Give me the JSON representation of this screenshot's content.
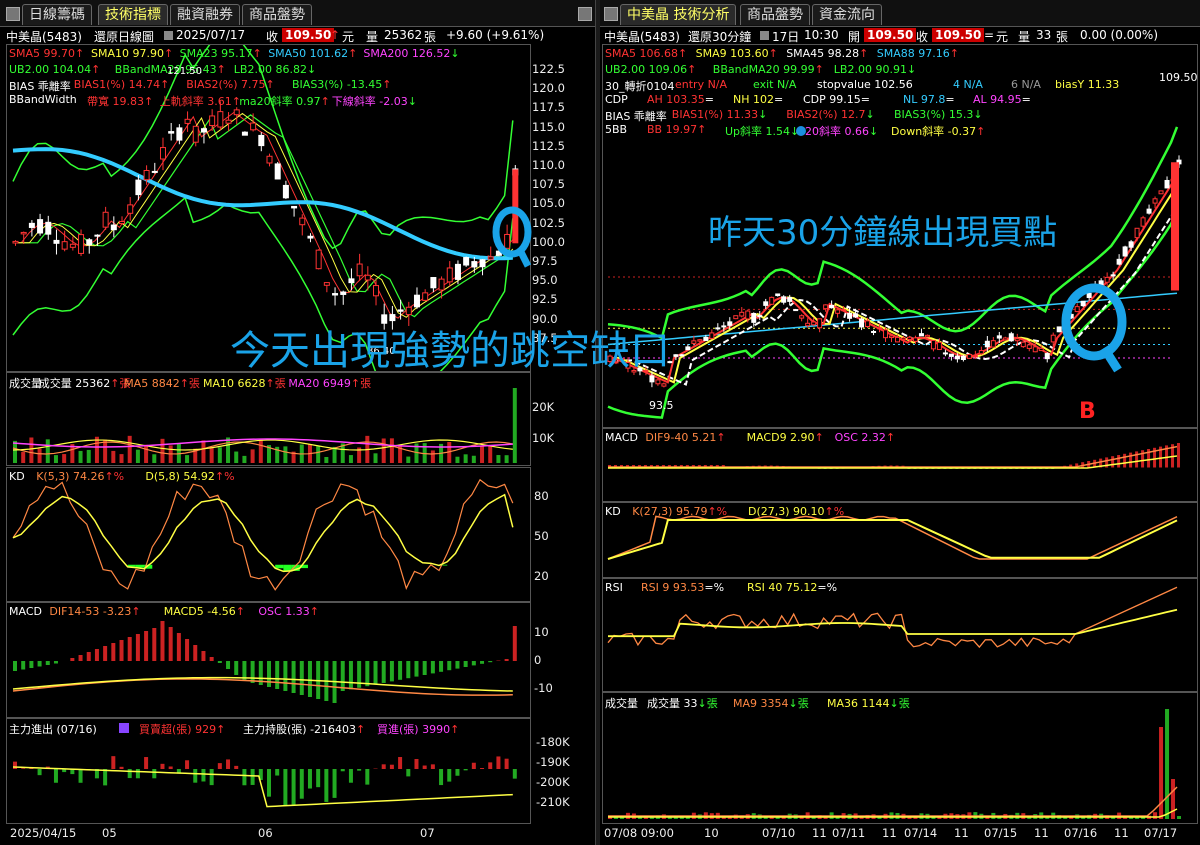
{
  "left": {
    "tabs": [
      "日線籌碼",
      "技術指標",
      "融資融券",
      "商品盤勢"
    ],
    "header": {
      "stock": "中美晶(5483)",
      "chart_mode": "還原日線圖",
      "date": "2025/07/17",
      "close_label": "收",
      "close": "109.50",
      "unit": "元",
      "vol_label": "量",
      "volume": "25362",
      "vol_unit": "張",
      "change": "+9.60 (+9.61%)"
    },
    "price_legend": {
      "row1": [
        {
          "text": "SMA5 99.70",
          "arrow": "↑",
          "color": "#ff3333"
        },
        {
          "text": "SMA10 97.90",
          "arrow": "↑",
          "color": "#ffff44"
        },
        {
          "text": "SMA23 95.17",
          "arrow": "↑",
          "color": "#33ff33"
        },
        {
          "text": "SMA50 101.62",
          "arrow": "↑",
          "color": "#33ccff"
        },
        {
          "text": "SMA200 126.52",
          "arrow": "↓",
          "color": "#ff44ff"
        }
      ],
      "row2": [
        {
          "text": "UB2.00 104.04",
          "arrow": "↑",
          "color": "#33ff33"
        },
        {
          "text": "BBandMA20 95.43",
          "arrow": "↑",
          "color": "#33ff33"
        },
        {
          "text": "LB2.00 86.82",
          "arrow": "↓",
          "color": "#33ff33"
        }
      ],
      "row3": [
        {
          "text": "BIAS 乖離率",
          "arrow": "",
          "color": "#ffffff"
        },
        {
          "text": "BIAS1(%) 14.74",
          "arrow": "↑",
          "color": "#ff3333"
        },
        {
          "text": "BIAS2(%) 7.75",
          "arrow": "↑",
          "color": "#ff3333"
        },
        {
          "text": "BIAS3(%) -13.45",
          "arrow": "↑",
          "color": "#33ff33"
        }
      ],
      "row4": [
        {
          "text": "BBandWidth",
          "arrow": "",
          "color": "#ffffff"
        },
        {
          "text": "帶寬 19.83",
          "arrow": "↑",
          "color": "#ff3333"
        },
        {
          "text": "上軌斜率 3.61",
          "arrow": "↑",
          "color": "#ff3333"
        },
        {
          "text": "ma20斜率 0.97",
          "arrow": "↑",
          "color": "#33ff33"
        },
        {
          "text": "下線斜率 -2.03",
          "arrow": "↓",
          "color": "#ff44ff"
        }
      ]
    },
    "price_axis": [
      "122.5",
      "120.0",
      "117.5",
      "115.0",
      "112.5",
      "110.0",
      "107.5",
      "105.0",
      "102.5",
      "100.0",
      "97.5",
      "95.0",
      "92.5",
      "90.0",
      "87.5"
    ],
    "price_notes": {
      "high": "121.50",
      "low": "86.40"
    },
    "volume_legend": [
      {
        "text": "成交量",
        "arrow": "",
        "color": "#ffffff"
      },
      {
        "text": "成交量 25362",
        "arrow": "↑張",
        "color": "#ffffff"
      },
      {
        "text": "MA5 8842",
        "arrow": "↑張",
        "color": "#ff8844"
      },
      {
        "text": "MA10 6628",
        "arrow": "↑張",
        "color": "#ffff44"
      },
      {
        "text": "MA20 6949",
        "arrow": "↑張",
        "color": "#ff44ff"
      }
    ],
    "volume_axis": [
      "20K",
      "10K"
    ],
    "kd_legend": [
      {
        "text": "KD",
        "arrow": "",
        "color": "#ffffff"
      },
      {
        "text": "K(5,3) 74.26",
        "arrow": "↑%",
        "color": "#ff8844"
      },
      {
        "text": "D(5,8) 54.92",
        "arrow": "↑%",
        "color": "#ffff44"
      }
    ],
    "kd_axis": [
      "80",
      "50",
      "20"
    ],
    "macd_legend": [
      {
        "text": "MACD",
        "arrow": "",
        "color": "#ffffff"
      },
      {
        "text": "DIF14-53 -3.23",
        "arrow": "↑",
        "color": "#ff8844"
      },
      {
        "text": "MACD5 -4.56",
        "arrow": "↑",
        "color": "#ffff44"
      },
      {
        "text": "OSC 1.33",
        "arrow": "↑",
        "color": "#ff44ff"
      }
    ],
    "macd_axis": [
      "10",
      "0",
      "-10"
    ],
    "main_legend": [
      {
        "text": "主力進出 (07/16)",
        "arrow": "",
        "color": "#ffffff"
      },
      {
        "text": "買賣超(張) 929",
        "arrow": "↑",
        "color": "#ff3333"
      },
      {
        "text": "主力持股(張) -216403",
        "arrow": "↑",
        "color": "#ffffff"
      },
      {
        "text": "買進(張) 3990",
        "arrow": "↑",
        "color": "#ff44ff"
      }
    ],
    "main_axis": [
      "-180K",
      "-190K",
      "-200K",
      "-210K"
    ],
    "x_axis": [
      "2025/04/15",
      "05",
      "06",
      "07"
    ],
    "annotation": "今天出現強勢的跳空缺口"
  },
  "right": {
    "tabs": [
      "中美晶 技術分析",
      "商品盤勢",
      "資金流向"
    ],
    "header": {
      "stock": "中美晶(5483)",
      "chart_mode": "還原30分鐘",
      "day": "17日",
      "time": "10:30",
      "open_label": "開",
      "open": "109.50",
      "close_label": "收",
      "close": "109.50",
      "unit": "元",
      "vol_label": "量",
      "volume": "33",
      "vol_unit": "張",
      "change": "0.00 (0.00%)"
    },
    "price_legend": {
      "row1": [
        {
          "text": "SMA5 106.68",
          "arrow": "↑",
          "color": "#ff3333"
        },
        {
          "text": "SMA9 103.60",
          "arrow": "↑",
          "color": "#ffff44"
        },
        {
          "text": "SMA45 98.28",
          "arrow": "↑",
          "color": "#ffffff"
        },
        {
          "text": "SMA88 97.16",
          "arrow": "↑",
          "color": "#33ccff"
        }
      ],
      "row2": [
        {
          "text": "UB2.00 109.06",
          "arrow": "↑",
          "color": "#33ff33"
        },
        {
          "text": "BBandMA20 99.99",
          "arrow": "↑",
          "color": "#33ff33"
        },
        {
          "text": "LB2.00 90.91",
          "arrow": "↓",
          "color": "#33ff33"
        }
      ],
      "row3": [
        {
          "text": "30_轉折0104",
          "arrow": "",
          "color": "#ffffff"
        },
        {
          "text": "entry N/A",
          "arrow": "",
          "color": "#ff3333"
        },
        {
          "text": "exit N/A",
          "arrow": "",
          "color": "#33ff33"
        },
        {
          "text": "stopvalue 102.56",
          "arrow": "",
          "color": "#ffffff"
        },
        {
          "text": "4 N/A",
          "arrow": "",
          "color": "#33ccff"
        },
        {
          "text": "6 N/A",
          "arrow": "",
          "color": "#999999"
        },
        {
          "text": "biasY 11.33",
          "arrow": "",
          "color": "#ffff44"
        }
      ],
      "row4": [
        {
          "text": "CDP",
          "arrow": "",
          "color": "#ffffff"
        },
        {
          "text": "AH 103.35",
          "arrow": "=",
          "color": "#ff3333"
        },
        {
          "text": "NH 102",
          "arrow": "=",
          "color": "#ffff44"
        },
        {
          "text": "CDP 99.15",
          "arrow": "=",
          "color": "#ffffff"
        },
        {
          "text": "NL 97.8",
          "arrow": "=",
          "color": "#33ccff"
        },
        {
          "text": "AL 94.95",
          "arrow": "=",
          "color": "#ff44ff"
        }
      ],
      "row5": [
        {
          "text": "BIAS 乖離率",
          "arrow": "",
          "color": "#ffffff"
        },
        {
          "text": "BIAS1(%) 11.33",
          "arrow": "↓",
          "color": "#ff3333"
        },
        {
          "text": "BIAS2(%) 12.7",
          "arrow": "↓",
          "color": "#ff3333"
        },
        {
          "text": "BIAS3(%) 15.3",
          "arrow": "↓",
          "color": "#33ff33"
        }
      ],
      "row6": [
        {
          "text": "5BB",
          "arrow": "",
          "color": "#ffffff"
        },
        {
          "text": "BB 19.97",
          "arrow": "↑",
          "color": "#ff3333"
        },
        {
          "text": "Up斜率 1.54",
          "arrow": "↓",
          "color": "#33ff33"
        },
        {
          "text": "20斜率 0.66",
          "arrow": "↓",
          "color": "#ff44ff"
        },
        {
          "text": "Down斜率 -0.37",
          "arrow": "↑",
          "color": "#ffff44"
        }
      ]
    },
    "price_notes": {
      "high": "109.50",
      "low": "93.5",
      "signal": "B"
    },
    "macd_legend": [
      {
        "text": "MACD",
        "arrow": "",
        "color": "#ffffff"
      },
      {
        "text": "DIF9-40 5.21",
        "arrow": "↑",
        "color": "#ff8844"
      },
      {
        "text": "MACD9 2.90",
        "arrow": "↑",
        "color": "#ffff44"
      },
      {
        "text": "OSC 2.32",
        "arrow": "↑",
        "color": "#ff44ff"
      }
    ],
    "kd_legend": [
      {
        "text": "KD",
        "arrow": "",
        "color": "#ffffff"
      },
      {
        "text": "K(27,3) 95.79",
        "arrow": "↑%",
        "color": "#ff8844"
      },
      {
        "text": "D(27,3) 90.10",
        "arrow": "↑%",
        "color": "#ffff44"
      }
    ],
    "rsi_legend": [
      {
        "text": "RSI",
        "arrow": "",
        "color": "#ffffff"
      },
      {
        "text": "RSI 9 93.53",
        "arrow": "=%",
        "color": "#ff8844"
      },
      {
        "text": "RSI 40 75.12",
        "arrow": "=%",
        "color": "#ffff44"
      }
    ],
    "volume_legend": [
      {
        "text": "成交量",
        "arrow": "",
        "color": "#ffffff"
      },
      {
        "text": "成交量 33",
        "arrow": "↓張",
        "color": "#ffffff"
      },
      {
        "text": "MA9 3354",
        "arrow": "↓張",
        "color": "#ff8844"
      },
      {
        "text": "MA36 1144",
        "arrow": "↓張",
        "color": "#ffff44"
      }
    ],
    "x_axis": [
      "07/08 09:00",
      "10",
      "07/10",
      "11",
      "07/11",
      "11",
      "07/14",
      "11",
      "07/15",
      "11",
      "07/16",
      "11",
      "07/17"
    ],
    "annotation": "昨天30分鐘線出現買點"
  },
  "colors": {
    "red": "#ff3333",
    "green": "#33ff33",
    "cyan": "#33ccff",
    "yellow": "#ffff44",
    "magenta": "#ff44ff",
    "orange": "#ff8844",
    "annotation": "#1aa3e8"
  }
}
